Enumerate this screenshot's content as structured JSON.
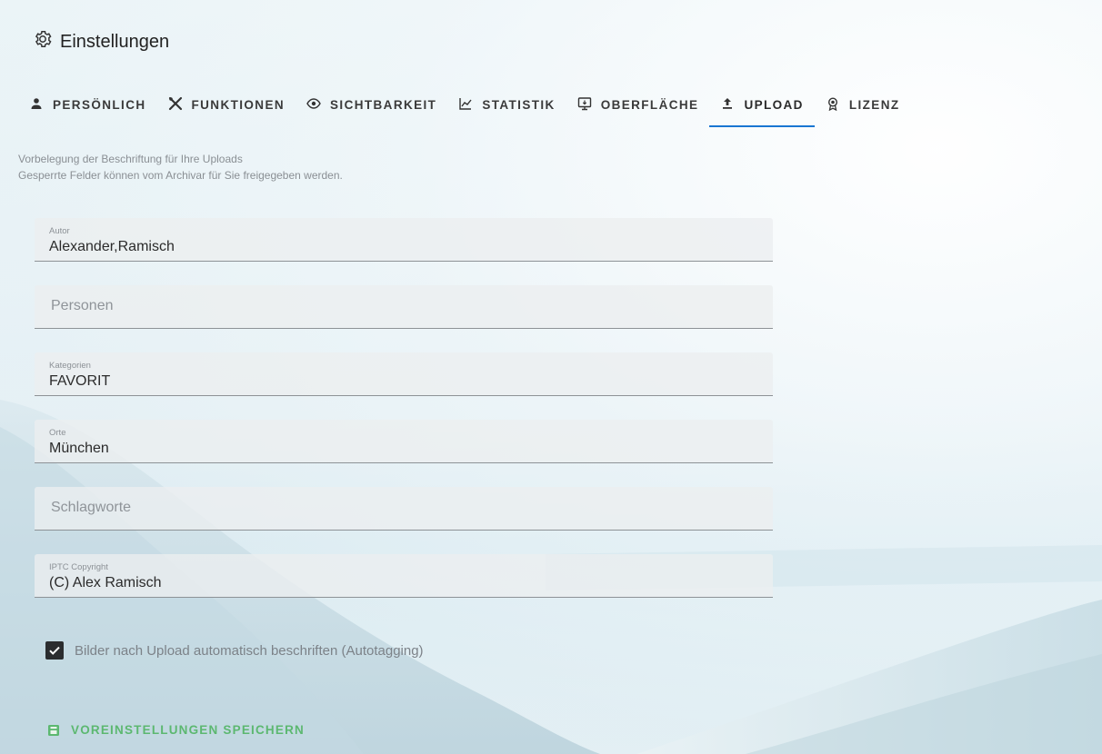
{
  "header": {
    "title": "Einstellungen",
    "icon": "gear-icon"
  },
  "tabs": [
    {
      "label": "PERSÖNLICH",
      "icon": "person-icon"
    },
    {
      "label": "FUNKTIONEN",
      "icon": "tools-icon"
    },
    {
      "label": "SICHTBARKEIT",
      "icon": "eye-icon"
    },
    {
      "label": "STATISTIK",
      "icon": "chart-icon"
    },
    {
      "label": "OBERFLÄCHE",
      "icon": "monitor-icon"
    },
    {
      "label": "UPLOAD",
      "icon": "upload-icon",
      "active": true
    },
    {
      "label": "LIZENZ",
      "icon": "license-icon"
    }
  ],
  "intro": {
    "line1": "Vorbelegung der Beschriftung für Ihre Uploads",
    "line2": "Gesperrte Felder können vom Archivar für Sie freigegeben werden."
  },
  "fields": {
    "autor": {
      "label": "Autor",
      "value": "Alexander,Ramisch"
    },
    "personen": {
      "placeholder": "Personen"
    },
    "kategorien": {
      "label": "Kategorien",
      "value": "FAVORIT"
    },
    "orte": {
      "label": "Orte",
      "value": "München"
    },
    "schlagworte": {
      "placeholder": "Schlagworte"
    },
    "copyright": {
      "label": "IPTC Copyright",
      "value": "(C) Alex Ramisch"
    }
  },
  "autotagging": {
    "label": "Bilder nach Upload automatisch beschriften (Autotagging)",
    "checked": true
  },
  "save_button": {
    "label": "VOREINSTELLUNGEN SPEICHERN",
    "color": "#5cb870"
  },
  "colors": {
    "accent": "#1976d2"
  }
}
